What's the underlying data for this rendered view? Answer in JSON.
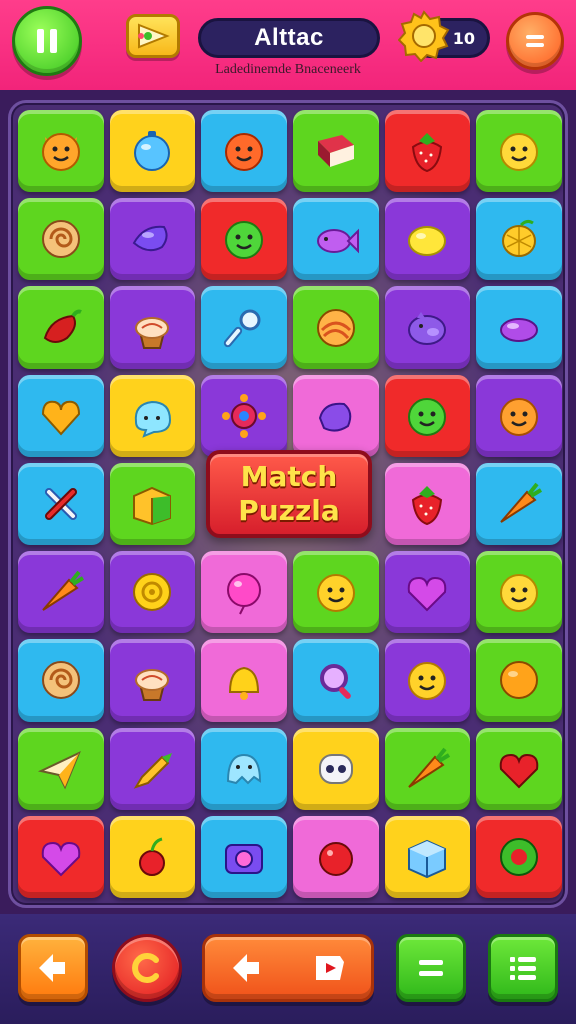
{
  "header": {
    "title": "Alttac",
    "subtitle": "Ladedinemde Bnaceneerk",
    "coins": "10",
    "pause_icon": "pause-icon",
    "flag_icon": "flag-icon",
    "coin_icon": "gear-coin-icon",
    "menu_icon": "menu-icon"
  },
  "board": {
    "banner_line1": "Match",
    "banner_line2": "Puzzla",
    "tiles": [
      [
        "cat-face",
        "blue-orb",
        "orange-blob",
        "book",
        "strawberry",
        "smiley"
      ],
      [
        "swirl-bun",
        "purple-gem",
        "green-face",
        "purple-fish",
        "lemon",
        "citrus"
      ],
      [
        "chili",
        "cupcake",
        "key",
        "swirl-ball",
        "purple-pig",
        "purple-candy"
      ],
      [
        "heart-leaf",
        "blue-blob",
        "flower-gem",
        "purple-drop",
        "green-face",
        "orange-face"
      ],
      [
        "crossed-sticks",
        "gift-box",
        "banner",
        "banner",
        "strawberry",
        "carrot"
      ],
      [
        "carrot",
        "coin-ring",
        "pink-balloon",
        "yellow-face",
        "purple-heart",
        "smiley"
      ],
      [
        "swirl-bun",
        "cupcake",
        "yellow-bell",
        "magnifier",
        "yellow-face",
        "orange-ball"
      ],
      [
        "paper-plane",
        "pen",
        "blue-ghost",
        "robot-face",
        "carrot",
        "red-heart"
      ],
      [
        "purple-heart",
        "cherry",
        "camera",
        "red-ball",
        "blue-box",
        "green-ring"
      ]
    ],
    "colors": {
      "green": "#5ed61f",
      "yellow": "#ffd21c",
      "blue": "#2fb9ef",
      "red": "#f02a2a",
      "purple": "#8a38d9",
      "pink": "#f06ad8"
    }
  },
  "footer": {
    "buttons": [
      "back-icon",
      "restart-icon",
      "undo-icon",
      "equal-icon",
      "list-icon"
    ]
  }
}
